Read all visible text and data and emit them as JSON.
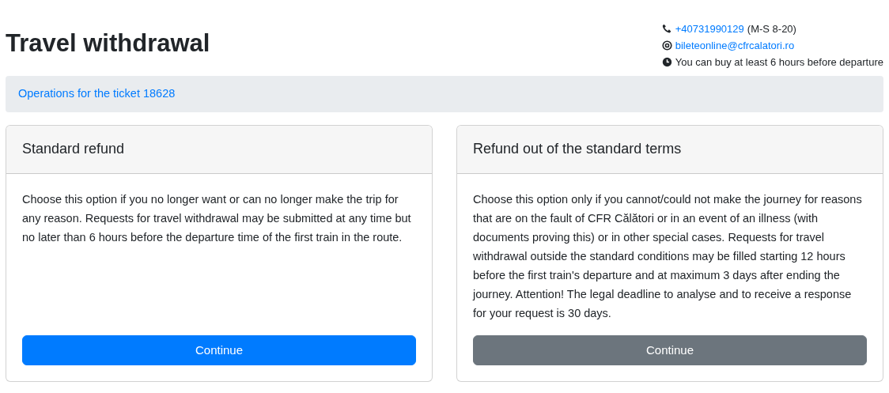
{
  "title": "Travel withdrawal",
  "contact": [
    {
      "kind": "phone",
      "link": "+40731990129",
      "note": "(M-S 8-20)"
    },
    {
      "kind": "email",
      "link": "bileteonline@cfrcalatori.ro"
    },
    {
      "kind": "clock",
      "note": "You can buy at least 6 hours before departure"
    }
  ],
  "breadcrumb": "Operations for the ticket 18628",
  "cards": [
    {
      "title": "Standard refund",
      "text": "Choose this option if you no longer want or can no longer make the trip for any reason. Requests for travel withdrawal may be submitted at any time but no later than 6 hours before the departure time of the first train in the route.",
      "button": {
        "label": "Continue",
        "kind": "primary"
      }
    },
    {
      "title": "Refund out of the standard terms",
      "text": "Choose this option only if you cannot/could not make the journey for reasons that are on the fault of CFR Călători or in an event of an illness (with documents proving this) or in other special cases. Requests for travel withdrawal outside the standard conditions may be filled starting 12 hours before the first train's departure and at maximum 3 days after ending the journey. Attention! The legal deadline to analyse and to receive a response for your request is 30 days.",
      "button": {
        "label": "Continue",
        "kind": "secondary"
      }
    }
  ]
}
